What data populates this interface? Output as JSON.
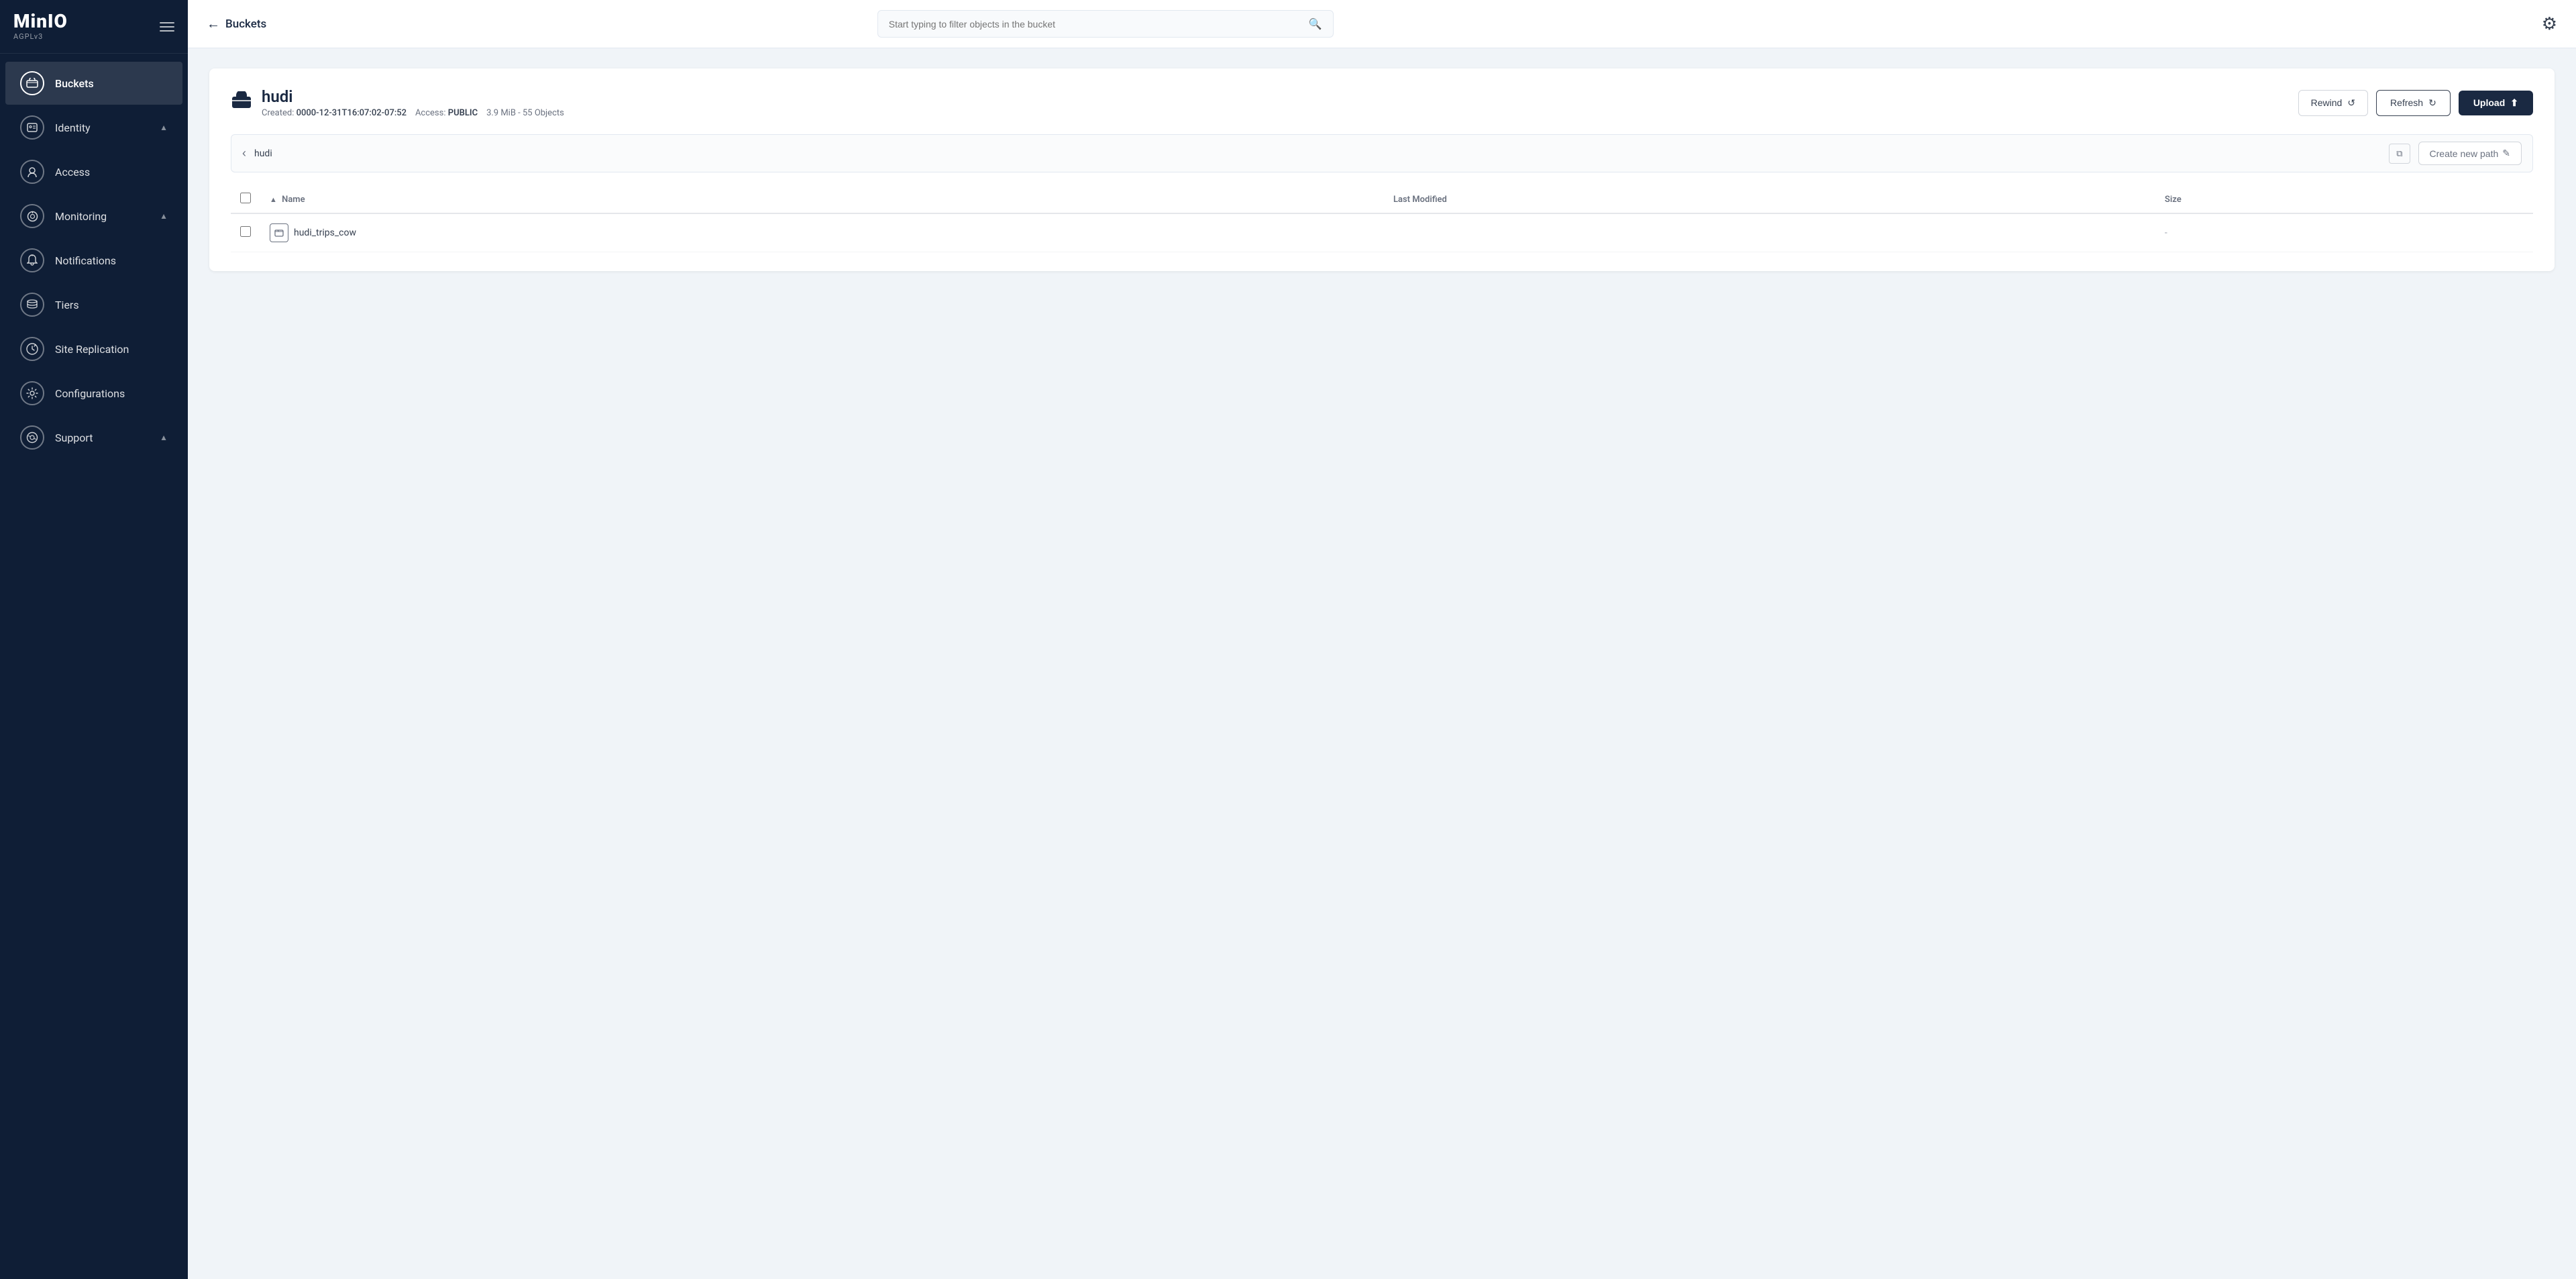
{
  "app": {
    "name": "MinIO",
    "version": "AGPLv3"
  },
  "sidebar": {
    "items": [
      {
        "id": "buckets",
        "label": "Buckets",
        "icon": "🪣",
        "active": true,
        "expandable": false
      },
      {
        "id": "identity",
        "label": "Identity",
        "icon": "🪪",
        "active": false,
        "expandable": true
      },
      {
        "id": "access",
        "label": "Access",
        "icon": "🔒",
        "active": false,
        "expandable": false
      },
      {
        "id": "monitoring",
        "label": "Monitoring",
        "icon": "🔍",
        "active": false,
        "expandable": true
      },
      {
        "id": "notifications",
        "label": "Notifications",
        "icon": "λ",
        "active": false,
        "expandable": false
      },
      {
        "id": "tiers",
        "label": "Tiers",
        "icon": "◈",
        "active": false,
        "expandable": false
      },
      {
        "id": "site-replication",
        "label": "Site Replication",
        "icon": "↻",
        "active": false,
        "expandable": false
      },
      {
        "id": "configurations",
        "label": "Configurations",
        "icon": "⚙",
        "active": false,
        "expandable": false
      },
      {
        "id": "support",
        "label": "Support",
        "icon": "❓",
        "active": false,
        "expandable": true
      }
    ]
  },
  "topbar": {
    "back_label": "Buckets",
    "search_placeholder": "Start typing to filter objects in the bucket"
  },
  "bucket": {
    "name": "hudi",
    "created_label": "Created:",
    "created_value": "0000-12-31T16:07:02-07:52",
    "access_label": "Access:",
    "access_value": "PUBLIC",
    "size_objects": "3.9 MiB - 55 Objects",
    "rewind_label": "Rewind",
    "refresh_label": "Refresh",
    "upload_label": "Upload",
    "path_value": "hudi",
    "create_path_label": "Create new path",
    "table": {
      "col_name": "Name",
      "col_last_modified": "Last Modified",
      "col_size": "Size",
      "rows": [
        {
          "name": "hudi_trips_cow",
          "last_modified": "",
          "size": "-",
          "type": "folder"
        }
      ]
    }
  }
}
